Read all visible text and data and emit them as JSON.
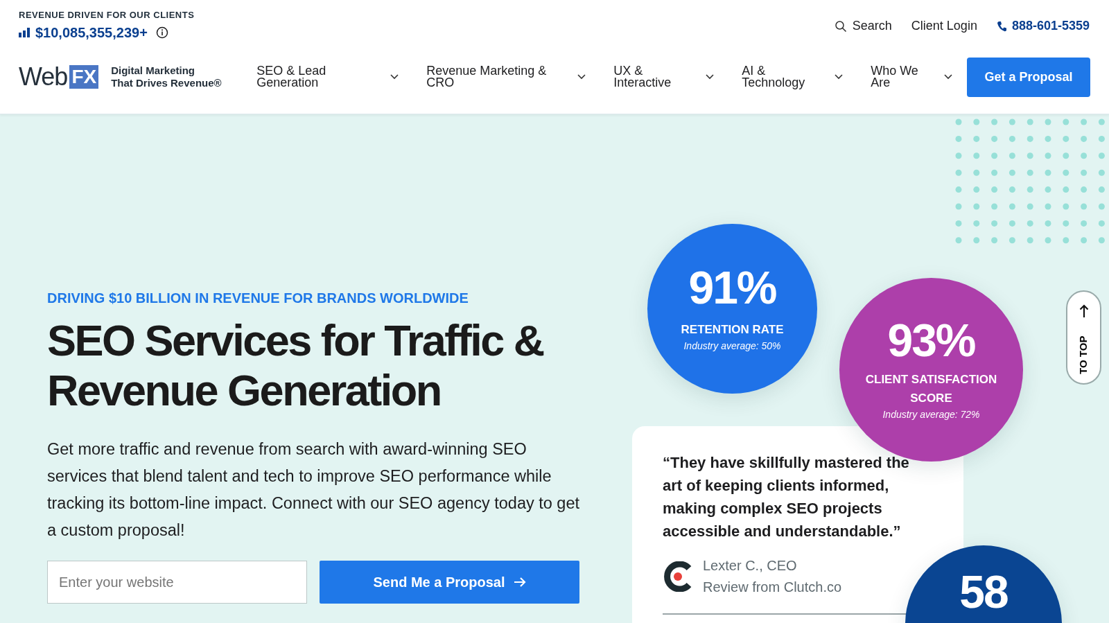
{
  "top_bar": {
    "revenue_label": "REVENUE DRIVEN FOR OUR CLIENTS",
    "revenue_amount": "$10,085,355,239+",
    "links": [
      {
        "kind": "search",
        "label": "Search"
      },
      {
        "kind": "login",
        "label": "Client Login"
      },
      {
        "kind": "phone",
        "label": "888-601-5359"
      }
    ]
  },
  "nav": {
    "logo": {
      "word": "Web",
      "mark": "FX"
    },
    "tagline": [
      "Digital Marketing",
      "That Drives Revenue®"
    ],
    "items": [
      {
        "label": "SEO & Lead Generation"
      },
      {
        "label": "Revenue Marketing & CRO"
      },
      {
        "label": "UX & Interactive"
      },
      {
        "label": "AI & Technology"
      },
      {
        "label": "Who We Are"
      }
    ],
    "cta": "Get a Proposal"
  },
  "hero": {
    "eyebrow": "DRIVING $10 BILLION IN REVENUE FOR BRANDS WORLDWIDE",
    "title_lines": [
      "SEO Services for Traffic &",
      "Revenue Generation"
    ],
    "description": "Get more traffic and revenue from search with award-winning SEO services that blend talent and tech to improve SEO performance while tracking its bottom-line impact. Connect with our SEO agency today to get a custom proposal!",
    "website_field": {
      "placeholder": "Enter your website"
    },
    "button": "Send Me a Proposal"
  },
  "stats": [
    {
      "value": "91%",
      "label": "RETENTION RATE",
      "note": "Industry average: 50%",
      "color": "#1f72e8"
    },
    {
      "value": "93%",
      "label": "CLIENT SATISFACTION SCORE",
      "note": "Industry average: 72%",
      "color": "#ad3faa"
    },
    {
      "value": "58",
      "color": "#0a4592"
    }
  ],
  "testimonial": {
    "quote": "“They have skillfully mastered the art of keeping clients informed, making complex SEO projects accessible and understandable.”",
    "author": "Lexter C., CEO",
    "source": "Review from Clutch.co"
  },
  "to_top": "TO TOP"
}
